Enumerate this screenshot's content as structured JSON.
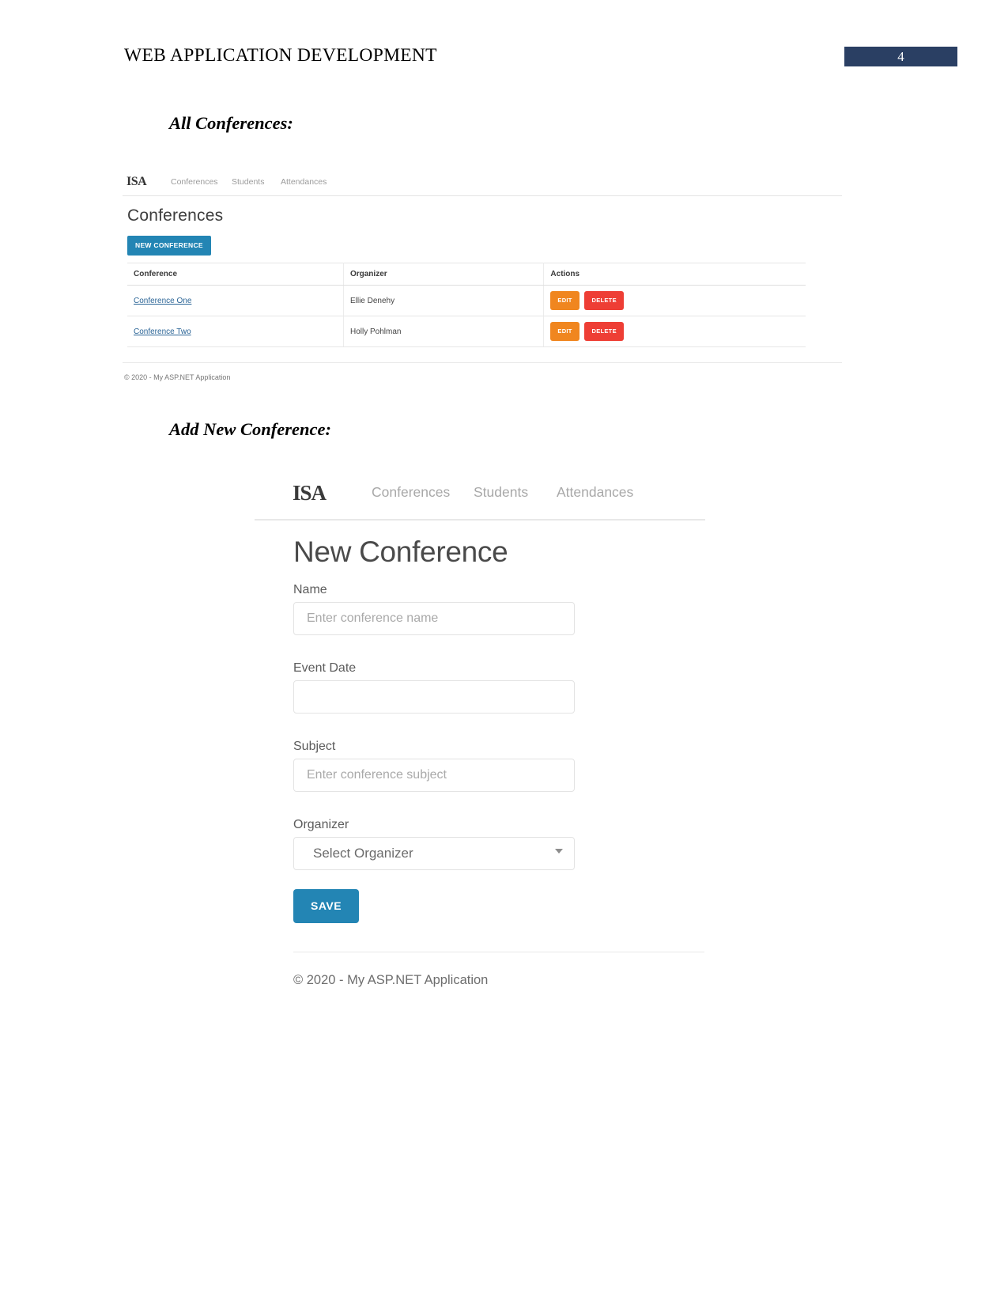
{
  "document": {
    "header_title": "WEB APPLICATION DEVELOPMENT",
    "page_number": "4",
    "header_badge_color": "#2a3f63",
    "sections": {
      "all_conferences": "All Conferences:",
      "add_new_conference": "Add New Conference:"
    }
  },
  "app": {
    "brand": "ISA",
    "nav": {
      "conferences": "Conferences",
      "students": "Students",
      "attendances": "Attendances"
    },
    "footer": "© 2020 - My ASP.NET Application",
    "accent_color": "#2385b4",
    "edit_color": "#f0861f",
    "delete_color": "#ee3e35"
  },
  "conferences_page": {
    "title": "Conferences",
    "new_button": "NEW CONFERENCE",
    "table": {
      "columns": [
        "Conference",
        "Organizer",
        "Actions"
      ],
      "rows": [
        {
          "conference": "Conference One",
          "organizer": "Ellie Denehy",
          "edit": "EDIT",
          "delete": "DELETE"
        },
        {
          "conference": "Conference Two",
          "organizer": "Holly Pohlman",
          "edit": "EDIT",
          "delete": "DELETE"
        }
      ]
    },
    "footer": "© 2020 - My ASP.NET Application"
  },
  "new_conference_page": {
    "title": "New Conference",
    "fields": {
      "name_label": "Name",
      "name_placeholder": "Enter conference name",
      "name_value": "",
      "date_label": "Event Date",
      "date_placeholder": "",
      "date_value": "",
      "subject_label": "Subject",
      "subject_placeholder": "Enter conference subject",
      "subject_value": "",
      "organizer_label": "Organizer",
      "organizer_selected": "Select Organizer"
    },
    "save_button": "SAVE",
    "footer": "© 2020 - My ASP.NET Application"
  }
}
